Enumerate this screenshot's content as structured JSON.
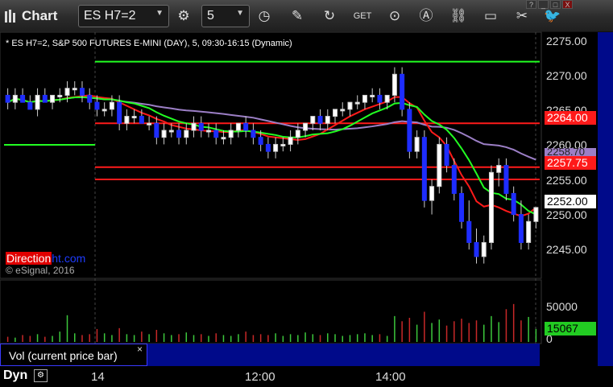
{
  "toolbar": {
    "title": "Chart",
    "symbol": "ES H7=2",
    "interval": "5",
    "window_controls": [
      "?",
      "_",
      "□",
      "X"
    ]
  },
  "chart": {
    "title": "* ES H7=2, S&P 500 FUTURES E-MINI (DAY), 5, 09:30-16:15 (Dynamic)",
    "watermark_a": "Direction",
    "watermark_b": "ht.com",
    "copyright": "© eSignal, 2016"
  },
  "price_axis": {
    "ticks": [
      "2275.00",
      "2270.00",
      "2265.00",
      "2260.00",
      "2255.00",
      "2250.00",
      "2245.00"
    ],
    "badge_red_top": "2264.00",
    "badge_purple": "2258.70",
    "badge_red_bottom": "2257.75",
    "badge_last": "2252.00"
  },
  "volume_axis": {
    "tick": "50000",
    "zero": "0",
    "badge_volume": "15067"
  },
  "volume_panel": {
    "label": "Vol (current price bar)",
    "close": "×"
  },
  "time_axis": {
    "labels": [
      "14",
      "12:00",
      "14:00"
    ]
  },
  "footer": {
    "mode": "Dyn"
  },
  "colors": {
    "up": "#ffffff",
    "down": "#1e2dff",
    "red_line": "#ff1a1a",
    "green_line": "#22ff22",
    "purple_line": "#9c7fc6",
    "vol_up": "#3cc83c",
    "vol_down": "#c82828"
  },
  "chart_data": {
    "type": "candlestick",
    "ylim": [
      2242,
      2277
    ],
    "horizontal_levels": [
      {
        "value": 2272.8,
        "color": "green"
      },
      {
        "value": 2264.0,
        "color": "red"
      },
      {
        "value": 2257.75,
        "color": "red"
      },
      {
        "value": 2256.0,
        "color": "red"
      },
      {
        "value": 2258.7,
        "color": "purple"
      }
    ],
    "candles": [
      [
        2268,
        2269,
        2266,
        2267
      ],
      [
        2267,
        2269,
        2266,
        2268
      ],
      [
        2268,
        2269,
        2267,
        2267
      ],
      [
        2267,
        2268,
        2266,
        2266
      ],
      [
        2266,
        2269,
        2265,
        2268
      ],
      [
        2268,
        2269,
        2267,
        2267
      ],
      [
        2267,
        2268,
        2266,
        2268
      ],
      [
        2268,
        2269,
        2267,
        2268
      ],
      [
        2268,
        2270,
        2267,
        2269
      ],
      [
        2269,
        2270,
        2268,
        2269
      ],
      [
        2269,
        2270,
        2267,
        2268
      ],
      [
        2268,
        2269,
        2266,
        2267
      ],
      [
        2267,
        2268,
        2265,
        2266
      ],
      [
        2266,
        2267,
        2265,
        2266
      ],
      [
        2266,
        2268,
        2265,
        2267
      ],
      [
        2267,
        2268,
        2263,
        2264
      ],
      [
        2264,
        2266,
        2263,
        2265
      ],
      [
        2265,
        2266,
        2264,
        2265
      ],
      [
        2265,
        2266,
        2264,
        2264
      ],
      [
        2264,
        2265,
        2263,
        2264
      ],
      [
        2264,
        2265,
        2261,
        2262
      ],
      [
        2262,
        2264,
        2261,
        2263
      ],
      [
        2263,
        2264,
        2262,
        2263
      ],
      [
        2263,
        2264,
        2261,
        2262
      ],
      [
        2262,
        2264,
        2261,
        2263
      ],
      [
        2263,
        2265,
        2262,
        2264
      ],
      [
        2264,
        2265,
        2262,
        2263
      ],
      [
        2263,
        2264,
        2262,
        2263
      ],
      [
        2263,
        2264,
        2261,
        2262
      ],
      [
        2262,
        2263,
        2261,
        2262
      ],
      [
        2262,
        2264,
        2261,
        2263
      ],
      [
        2263,
        2264,
        2262,
        2264
      ],
      [
        2264,
        2265,
        2262,
        2263
      ],
      [
        2263,
        2264,
        2261,
        2262
      ],
      [
        2262,
        2263,
        2260,
        2261
      ],
      [
        2261,
        2262,
        2259,
        2260
      ],
      [
        2260,
        2262,
        2259,
        2261
      ],
      [
        2261,
        2262,
        2260,
        2261
      ],
      [
        2261,
        2263,
        2260,
        2262
      ],
      [
        2262,
        2264,
        2261,
        2263
      ],
      [
        2263,
        2264,
        2262,
        2264
      ],
      [
        2264,
        2265,
        2263,
        2265
      ],
      [
        2265,
        2266,
        2263,
        2264
      ],
      [
        2264,
        2266,
        2263,
        2265
      ],
      [
        2265,
        2266,
        2264,
        2266
      ],
      [
        2266,
        2267,
        2265,
        2266
      ],
      [
        2266,
        2267,
        2265,
        2267
      ],
      [
        2267,
        2268,
        2266,
        2267
      ],
      [
        2267,
        2268,
        2266,
        2268
      ],
      [
        2268,
        2269,
        2267,
        2268
      ],
      [
        2268,
        2269,
        2266,
        2267
      ],
      [
        2267,
        2268,
        2266,
        2268
      ],
      [
        2268,
        2272,
        2267,
        2271
      ],
      [
        2271,
        2272,
        2265,
        2266
      ],
      [
        2266,
        2267,
        2259,
        2260
      ],
      [
        2260,
        2263,
        2259,
        2262
      ],
      [
        2262,
        2263,
        2252,
        2253
      ],
      [
        2253,
        2256,
        2251,
        2255
      ],
      [
        2255,
        2262,
        2254,
        2261
      ],
      [
        2261,
        2262,
        2257,
        2258
      ],
      [
        2258,
        2259,
        2253,
        2254
      ],
      [
        2254,
        2255,
        2249,
        2250
      ],
      [
        2250,
        2253,
        2246,
        2247
      ],
      [
        2247,
        2249,
        2244,
        2245
      ],
      [
        2245,
        2248,
        2244,
        2247
      ],
      [
        2247,
        2258,
        2246,
        2257
      ],
      [
        2257,
        2259,
        2255,
        2258
      ],
      [
        2258,
        2259,
        2253,
        2254
      ],
      [
        2254,
        2255,
        2250,
        2251
      ],
      [
        2251,
        2253,
        2246,
        2247
      ],
      [
        2247,
        2251,
        2246,
        2250
      ],
      [
        2250,
        2252,
        2249,
        2252
      ]
    ],
    "volume": [
      6000,
      5000,
      8000,
      7000,
      9000,
      6000,
      7000,
      12000,
      31000,
      10000,
      8000,
      9000,
      15000,
      10000,
      8000,
      16000,
      9000,
      8000,
      12000,
      9000,
      14000,
      10000,
      8000,
      9000,
      11000,
      8000,
      9000,
      7000,
      10000,
      8000,
      7000,
      9000,
      12000,
      8000,
      9000,
      8000,
      10000,
      7000,
      9000,
      8000,
      11000,
      9000,
      8000,
      10000,
      9000,
      7000,
      8000,
      9000,
      10000,
      8000,
      9000,
      7000,
      30000,
      24000,
      28000,
      20000,
      35000,
      22000,
      26000,
      19000,
      24000,
      27000,
      22000,
      25000,
      20000,
      30000,
      23000,
      38000,
      44000,
      25000,
      29000,
      15067
    ]
  }
}
